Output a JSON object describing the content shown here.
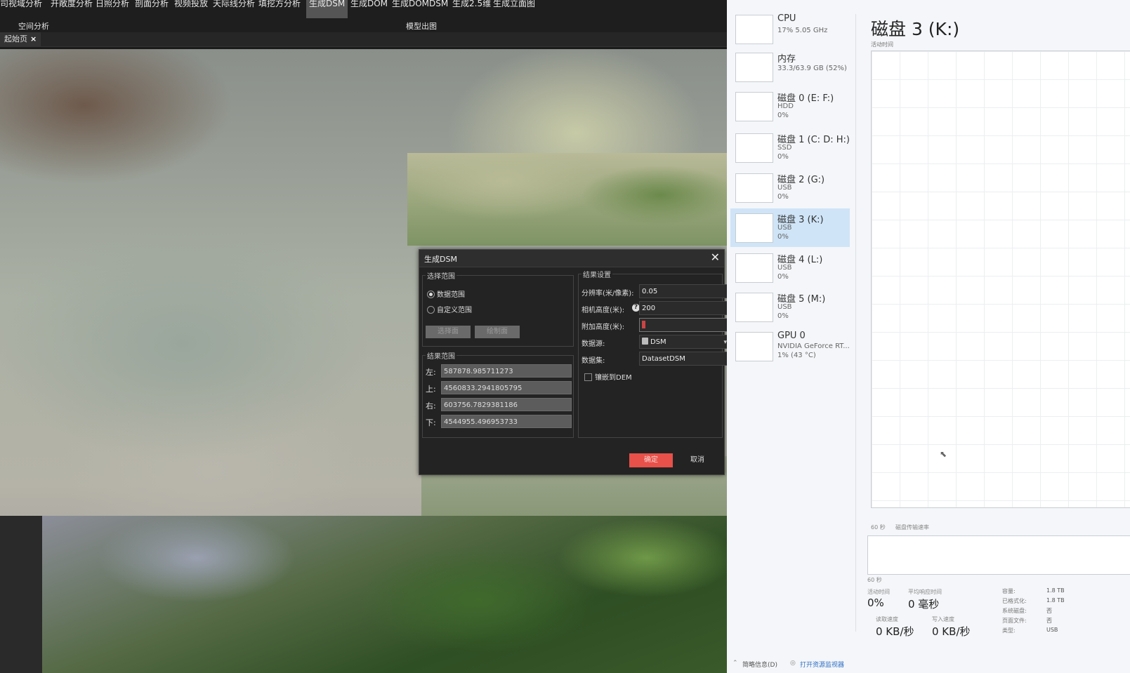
{
  "menubar": {
    "items": [
      "司视域分析",
      "开敞度分析",
      "日照分析",
      "剖面分析",
      "视频投放",
      "天际线分析",
      "填挖方分析",
      "生成DSM",
      "生成DOM",
      "生成DOMDSM",
      "生成2.5维",
      "生成立面图"
    ]
  },
  "ribbon": {
    "left_label": "空间分析",
    "center_label": "模型出图"
  },
  "doc_tab": {
    "label": "起始页",
    "close": "×"
  },
  "dialog": {
    "title": "生成DSM",
    "close": "✕",
    "range_group": {
      "label": "选择范围",
      "option_data": "数据范围",
      "option_custom": "自定义范围",
      "btn_select": "选择面",
      "btn_draw": "绘制面"
    },
    "result_range": {
      "label": "结果范围",
      "left_label": "左:",
      "left": "587878.985711273",
      "top_label": "上:",
      "top": "4560833.2941805795",
      "right_label": "右:",
      "right": "603756.7829381186",
      "bottom_label": "下:",
      "bottom": "4544955.496953733"
    },
    "settings": {
      "label": "结果设置",
      "resolution_label": "分辨率(米/像素):",
      "resolution": "0.05",
      "camera_height_label": "相机高度(米):",
      "camera_height": "200",
      "extra_height_label": "附加高度(米):",
      "extra_height": "0",
      "datasource_label": "数据源:",
      "datasource": "DSM",
      "dataset_label": "数据集:",
      "dataset": "DatasetDSM",
      "embed_label": "镶嵌到DEM"
    },
    "ok": "确定",
    "cancel": "取消"
  },
  "taskmgr": {
    "items": [
      {
        "name": "CPU",
        "sub1": "17% 5.05 GHz",
        "sub2": "",
        "sub3": ""
      },
      {
        "name": "内存",
        "sub1": "33.3/63.9 GB (52%)",
        "sub2": "",
        "sub3": ""
      },
      {
        "name": "磁盘 0 (E: F:)",
        "sub1": "HDD",
        "sub2": "0%",
        "sub3": ""
      },
      {
        "name": "磁盘 1 (C: D: H:)",
        "sub1": "SSD",
        "sub2": "0%",
        "sub3": ""
      },
      {
        "name": "磁盘 2 (G:)",
        "sub1": "USB",
        "sub2": "0%",
        "sub3": ""
      },
      {
        "name": "磁盘 3 (K:)",
        "sub1": "USB",
        "sub2": "0%",
        "sub3": ""
      },
      {
        "name": "磁盘 4 (L:)",
        "sub1": "USB",
        "sub2": "0%",
        "sub3": ""
      },
      {
        "name": "磁盘 5 (M:)",
        "sub1": "USB",
        "sub2": "0%",
        "sub3": ""
      },
      {
        "name": "GPU 0",
        "sub1": "NVIDIA GeForce RT...",
        "sub2": "1% (43 °C)",
        "sub3": ""
      }
    ],
    "title": "磁盘 3 (K:)",
    "graph_label": "活动时间",
    "graph_time": "60 秒",
    "graph2_label": "磁盘传输速率",
    "graph2_time": "60 秒",
    "active_time_label": "活动时间",
    "active_time": "0%",
    "avg_resp_label": "平均响应时间",
    "avg_resp": "0 毫秒",
    "read_label": "读取速度",
    "read": "0 KB/秒",
    "write_label": "写入速度",
    "write": "0 KB/秒",
    "props": [
      {
        "k": "容量:",
        "v": "1.8 TB"
      },
      {
        "k": "已格式化:",
        "v": "1.8 TB"
      },
      {
        "k": "系统磁盘:",
        "v": "否"
      },
      {
        "k": "页面文件:",
        "v": "否"
      },
      {
        "k": "类型:",
        "v": "USB"
      }
    ],
    "footer_less": "简略信息(D)",
    "footer_monitor": "打开资源监视器"
  }
}
